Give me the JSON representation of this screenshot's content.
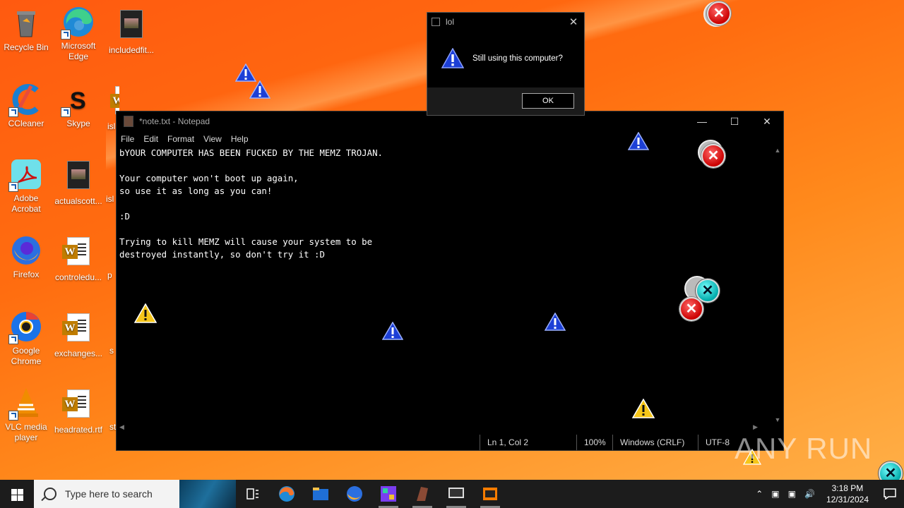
{
  "desktop": {
    "icons": [
      {
        "label": "Recycle Bin"
      },
      {
        "label": "Microsoft Edge"
      },
      {
        "label": "includedfit..."
      },
      {
        "label": "CCleaner"
      },
      {
        "label": "Skype"
      },
      {
        "label": "Adobe Acrobat"
      },
      {
        "label": "actualscott..."
      },
      {
        "label": "Firefox"
      },
      {
        "label": "controledu..."
      },
      {
        "label": "Google Chrome"
      },
      {
        "label": "exchanges..."
      },
      {
        "label": "VLC media player"
      },
      {
        "label": "headrated.rtf"
      }
    ],
    "partial_labels": [
      "isl",
      "isl",
      "p",
      "s",
      "st"
    ]
  },
  "notepad": {
    "title": "*note.txt - Notepad",
    "menu": [
      "File",
      "Edit",
      "Format",
      "View",
      "Help"
    ],
    "content": "bYOUR COMPUTER HAS BEEN FUCKED BY THE MEMZ TROJAN.\n\nYour computer won't boot up again,\nso use it as long as you can!\n\n:D\n\nTrying to kill MEMZ will cause your system to be\ndestroyed instantly, so don't try it :D",
    "status": {
      "position": "Ln 1, Col 2",
      "zoom": "100%",
      "line_ending": "Windows (CRLF)",
      "encoding": "UTF-8"
    }
  },
  "dialog": {
    "title": "lol",
    "message": "Still using this computer?",
    "ok_label": "OK"
  },
  "taskbar": {
    "search_placeholder": "Type here to search",
    "time": "3:18 PM",
    "date": "12/31/2024"
  },
  "watermark": "ANY RUN"
}
